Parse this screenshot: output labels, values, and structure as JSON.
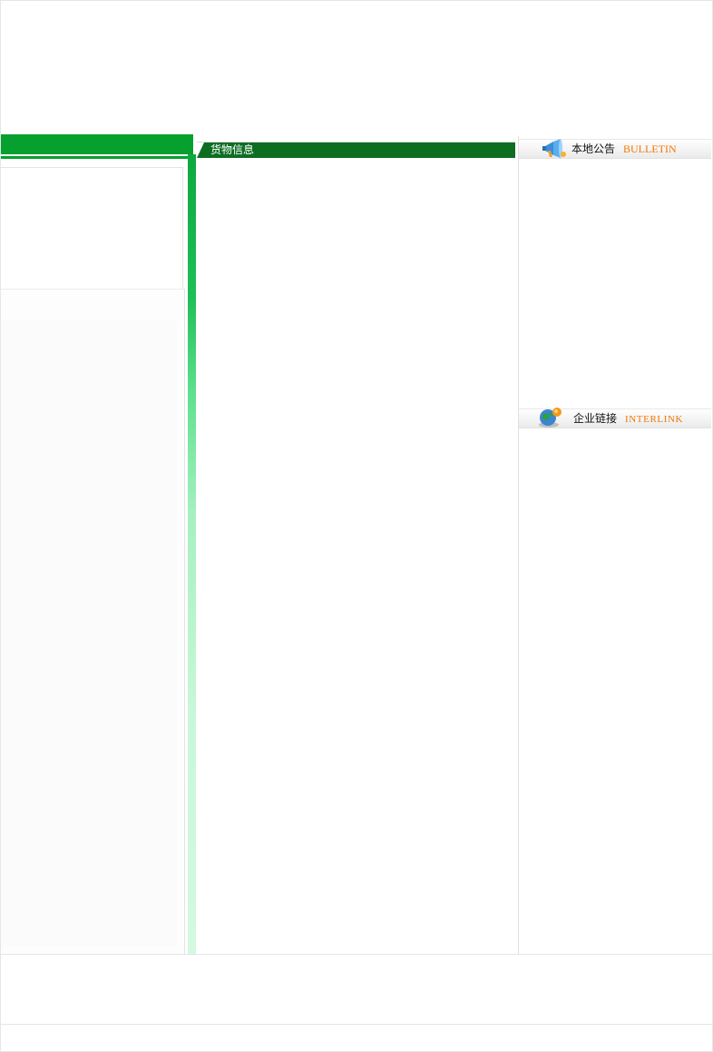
{
  "main": {
    "goods_title": "货物信息"
  },
  "right": {
    "bulletin": {
      "title_cn": "本地公告",
      "title_en": "BULLETIN"
    },
    "interlink": {
      "title_cn": "企业链接",
      "title_en": "INTERLINK"
    }
  },
  "colors": {
    "left_header": "#05a02e",
    "mid_header": "#0d6e22",
    "accent_orange": "#f07800"
  },
  "icons": [
    "megaphone-icon",
    "globe-icon"
  ]
}
